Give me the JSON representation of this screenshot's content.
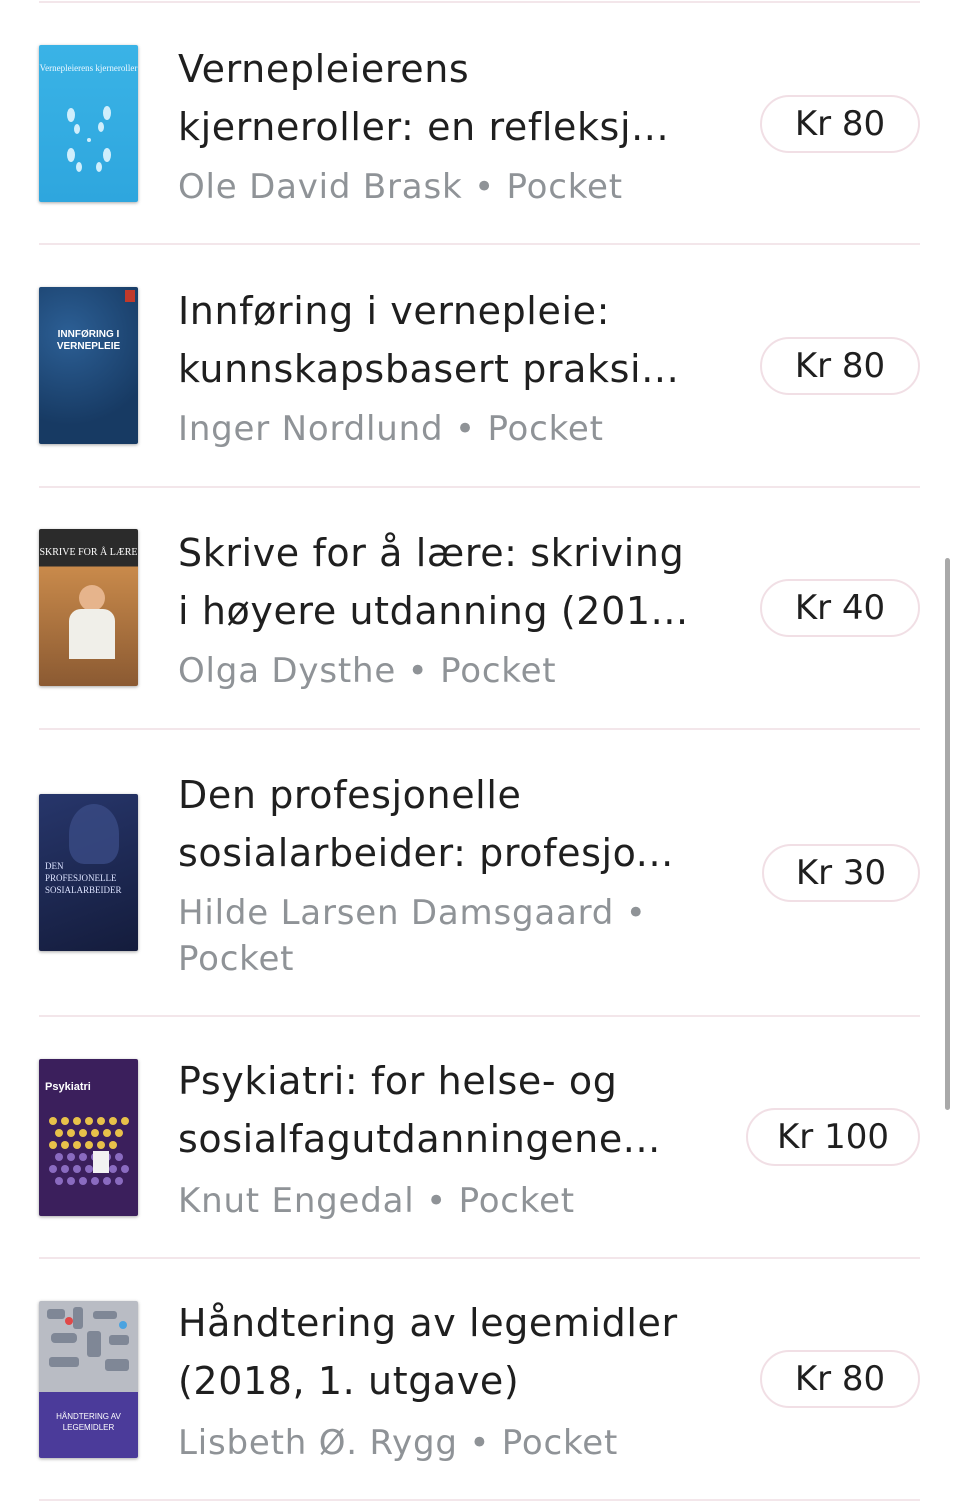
{
  "books": [
    {
      "title_line1": "Vernepleierens",
      "title_line2": "kjerneroller: en refleksj...",
      "author": "Ole David Brask",
      "format": "Pocket",
      "price": "Kr 80",
      "cover_text": "Vernepleierens kjerneroller"
    },
    {
      "title_line1": "Innføring i vernepleie:",
      "title_line2": "kunnskapsbasert praksi...",
      "author": "Inger Nordlund",
      "format": "Pocket",
      "price": "Kr 80",
      "cover_text": "INNFØRING I VERNEPLEIE"
    },
    {
      "title_line1": "Skrive for å lære: skriving",
      "title_line2": "i høyere utdanning (201...",
      "author": "Olga Dysthe",
      "format": "Pocket",
      "price": "Kr 40",
      "cover_text": "SKRIVE FOR Å LÆRE"
    },
    {
      "title_line1": "Den profesjonelle",
      "title_line2": "sosialarbeider: profesjo...",
      "author": "Hilde Larsen Damsgaard",
      "format": "Pocket",
      "price": "Kr 30",
      "cover_text": "DEN PROFESJONELLE SOSIALARBEIDER"
    },
    {
      "title_line1": "Psykiatri: for helse- og",
      "title_line2": "sosialfagutdanningene...",
      "author": "Knut Engedal",
      "format": "Pocket",
      "price": "Kr 100",
      "cover_text": "Psykiatri"
    },
    {
      "title_line1": "Håndtering av legemidler",
      "title_line2": "(2018, 1. utgave)",
      "author": "Lisbeth Ø. Rygg",
      "format": "Pocket",
      "price": "Kr 80",
      "cover_text": "HÅNDTERING AV LEGEMIDLER"
    }
  ],
  "separator": "•",
  "colors": {
    "divider": "#f3e6ea",
    "price_border": "#f1dfe5",
    "meta_text": "#8f9397",
    "title_text": "#1f1f1f"
  }
}
